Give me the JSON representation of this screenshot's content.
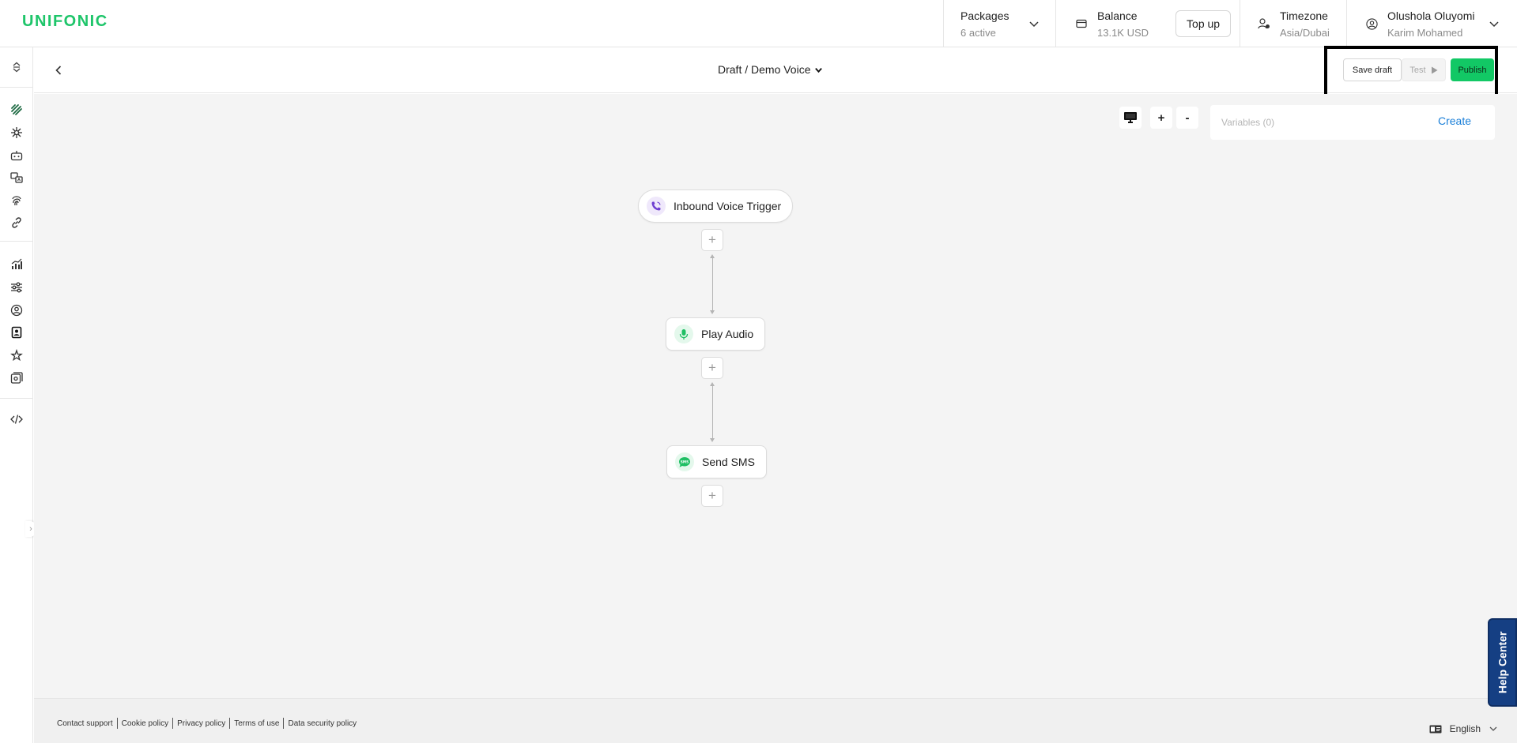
{
  "header": {
    "logo": "UNIFONIC",
    "packages": {
      "title": "Packages",
      "sub": "6 active"
    },
    "balance": {
      "title": "Balance",
      "sub": "13.1K USD",
      "topup_label": "Top up"
    },
    "timezone": {
      "title": "Timezone",
      "sub": "Asia/Dubai"
    },
    "user": {
      "name": "Olushola Oluyomi",
      "account": "Karim Mohamed"
    }
  },
  "editor": {
    "breadcrumb": "Draft / Demo Voice",
    "save_label": "Save draft",
    "test_label": "Test",
    "publish_label": "Publish"
  },
  "canvas": {
    "zoom_in": "+",
    "zoom_out": "-",
    "variables_label": "Variables (0)",
    "create_label": "Create",
    "add_symbol": "+",
    "nodes": [
      {
        "label": "Inbound Voice Trigger",
        "icon": "phone-icon",
        "icon_color": "#6f3fd1"
      },
      {
        "label": "Play Audio",
        "icon": "microphone-icon",
        "icon_color": "#1fbf64"
      },
      {
        "label": "Send SMS",
        "icon": "sms-bubble-icon",
        "icon_color": "#1fbf64"
      }
    ]
  },
  "sidebar": {
    "icons": [
      "switch-icon",
      "channels-icon",
      "burst-icon",
      "chatbot-icon",
      "translate-icon",
      "fingerprint-icon",
      "link-icon",
      "analytics-icon",
      "sliders-icon",
      "account-icon",
      "contacts-icon",
      "integrations-icon",
      "gallery-icon",
      "code-icon"
    ]
  },
  "footer": {
    "links": [
      "Contact support",
      "Cookie policy",
      "Privacy policy",
      "Terms of use",
      "Data security policy"
    ],
    "language": "English"
  },
  "help_center": "Help Center",
  "colors": {
    "brand": "#1ec56a",
    "publish": "#12c865",
    "link": "#1a7fd8",
    "help_tab": "#153f83"
  }
}
